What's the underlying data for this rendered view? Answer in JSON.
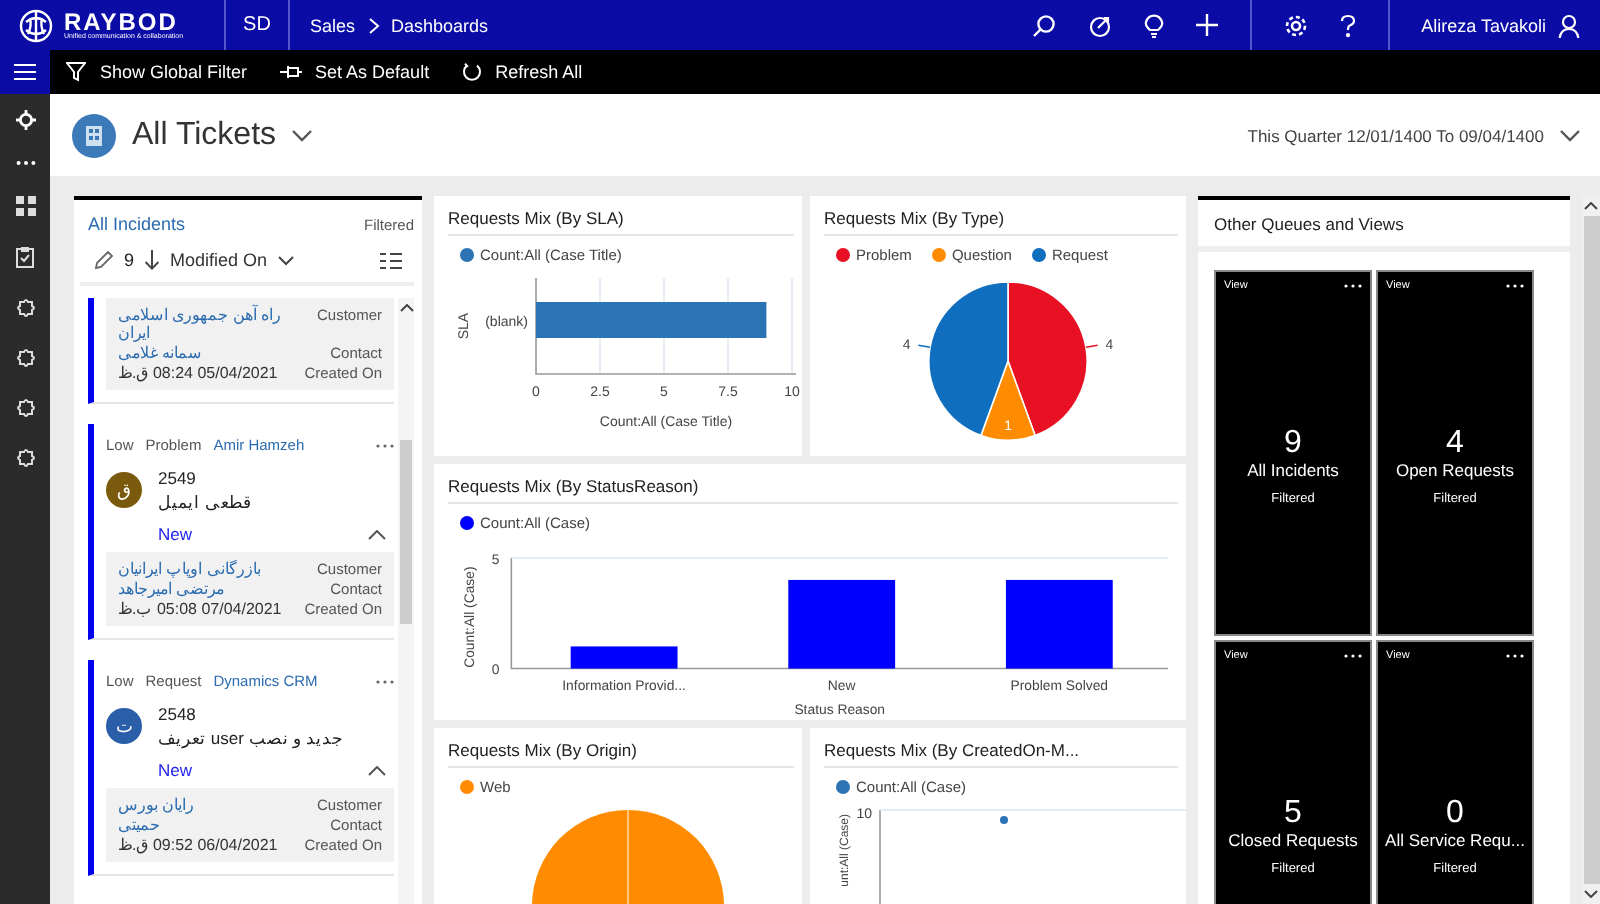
{
  "topbar": {
    "brand": "RAYBOD",
    "tagline": "Unified communication & collaboration",
    "app_code": "SD",
    "breadcrumb": [
      "Sales",
      "Dashboards"
    ],
    "user": "Alireza Tavakoli"
  },
  "command_bar": [
    {
      "kind": "filter",
      "label": "Show Global Filter"
    },
    {
      "kind": "pin",
      "label": "Set As Default"
    },
    {
      "kind": "refresh",
      "label": "Refresh All"
    }
  ],
  "header": {
    "title": "All Tickets",
    "date_range": "This Quarter 12/01/1400 To 09/04/1400"
  },
  "incidents": {
    "title": "All Incidents",
    "filter_note": "Filtered",
    "count": "9",
    "sort_field": "Modified On",
    "cards": [
      {
        "kind": "details_only",
        "details": [
          {
            "label": "Customer",
            "value": "راه آهن جمهوری اسلامی ایران",
            "link": true
          },
          {
            "label": "Contact",
            "value": "سمانه غلامی",
            "link": true
          },
          {
            "label": "Created On",
            "value": "05/04/2021 08:24 ق.ظ",
            "link": false
          }
        ]
      },
      {
        "kind": "full",
        "priority": "Low",
        "type": "Problem",
        "owner": "Amir Hamzeh",
        "avatar": "ق",
        "color": "#7a5a0c",
        "number": "2549",
        "subject": "قطعی ایمیل",
        "status": "New",
        "details": [
          {
            "label": "Customer",
            "value": "بازرگانی اوپاپ ایرانیان",
            "link": true
          },
          {
            "label": "Contact",
            "value": "مرتضی امیرجاهد",
            "link": true
          },
          {
            "label": "Created On",
            "value": "07/04/2021 05:08 ب.ظ",
            "link": false
          }
        ]
      },
      {
        "kind": "full",
        "priority": "Low",
        "type": "Request",
        "owner": "Dynamics CRM",
        "avatar": "ت",
        "color": "#2a5ea8",
        "number": "2548",
        "subject": "جدید و نصب user تعریف",
        "status": "New",
        "details": [
          {
            "label": "Customer",
            "value": "رایان بورس",
            "link": true
          },
          {
            "label": "Contact",
            "value": "حمیتی",
            "link": true
          },
          {
            "label": "Created On",
            "value": "06/04/2021 09:52 ق.ظ",
            "link": false
          }
        ]
      }
    ]
  },
  "sla_chart": {
    "title": "Requests Mix (By SLA)",
    "chart_data": {
      "type": "bar",
      "orientation": "horizontal",
      "categories": [
        "(blank)"
      ],
      "series": [
        {
          "name": "Count:All (Case Title)",
          "color": "#2b73b4",
          "values": [
            9
          ]
        }
      ],
      "xlabel": "Count:All (Case Title)",
      "ylabel": "SLA",
      "xlim": [
        0,
        10
      ],
      "xticks": [
        0,
        2.5,
        5,
        7.5,
        10
      ],
      "grid": true
    }
  },
  "type_chart": {
    "title": "Requests Mix (By Type)",
    "legend": [
      {
        "color": "#e81123"
      },
      {
        "color": "#ff8c00"
      },
      {
        "color": "#106ebe"
      }
    ],
    "chart_data": {
      "type": "pie",
      "categories": [
        "Problem",
        "Question",
        "Request"
      ],
      "values": [
        4,
        1,
        4
      ],
      "data_labels": true
    }
  },
  "status_chart": {
    "title": "Requests Mix (By StatusReason)",
    "chart_data": {
      "type": "bar",
      "categories": [
        "Information Provid...",
        "New",
        "Problem Solved"
      ],
      "series": [
        {
          "name": "Count:All (Case)",
          "color": "#0000ff",
          "values": [
            1,
            4,
            4
          ]
        }
      ],
      "xlabel": "Status Reason",
      "ylabel": "Count:All (Case)",
      "ylim": [
        0,
        5
      ],
      "yticks": [
        0,
        5
      ]
    }
  },
  "origin_chart": {
    "title": "Requests Mix (By Origin)",
    "legend": [
      {
        "label": "Web",
        "color": "#ff8c00"
      }
    ]
  },
  "created_chart": {
    "title": "Requests Mix (By CreatedOn-M...",
    "legend": [
      {
        "label": "Count:All (Case)",
        "color": "#2b73b4"
      }
    ],
    "ytick": "10",
    "ylabel": "unt:All (Case)"
  },
  "queues": {
    "title": "Other Queues and Views",
    "tiles": [
      {
        "tag": "View",
        "count": "9",
        "name": "All Incidents",
        "note": "Filtered"
      },
      {
        "tag": "View",
        "count": "4",
        "name": "Open Requests",
        "note": "Filtered"
      },
      {
        "tag": "View",
        "count": "5",
        "name": "Closed Requests",
        "note": "Filtered"
      },
      {
        "tag": "View",
        "count": "0",
        "name": "All Service Requ...",
        "note": "Filtered"
      }
    ]
  }
}
